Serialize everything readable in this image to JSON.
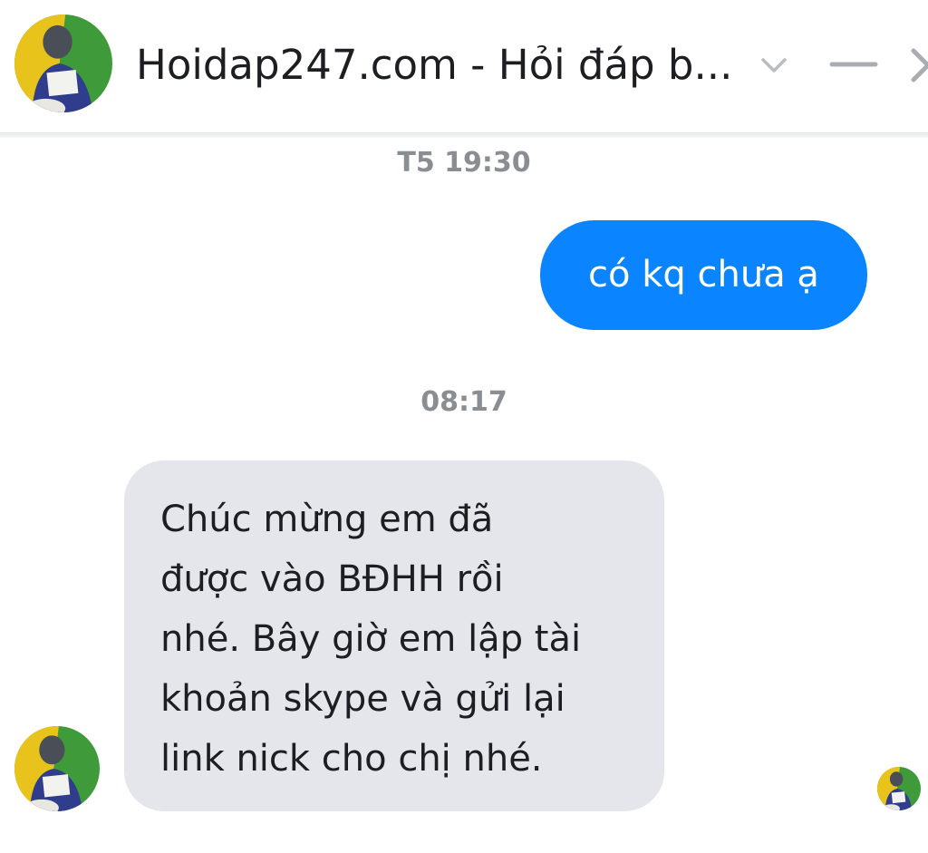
{
  "header": {
    "title": "Hoidap247.com - Hỏi đáp b...",
    "icons": {
      "avatar": "avatar-icon",
      "options": "chevron-down-icon",
      "minimize": "minimize-icon",
      "close": "close-icon"
    }
  },
  "messages": [
    {
      "type": "timestamp",
      "text": "T5 19:30"
    },
    {
      "type": "outgoing",
      "text": "có kq chưa ạ"
    },
    {
      "type": "timestamp",
      "text": "08:17"
    },
    {
      "type": "incoming",
      "text": "Chúc mừng em đã\nđược vào BĐHH rồi\nnhé. Bây giờ em lập tài\nkhoản skype và gửi lại\nlink nick cho chị nhé."
    }
  ],
  "colors": {
    "outgoing_bubble": "#0a84ff",
    "incoming_bubble": "#e4e6eb",
    "timestamp_text": "#8a8d91",
    "title_text": "#1c1e21"
  }
}
